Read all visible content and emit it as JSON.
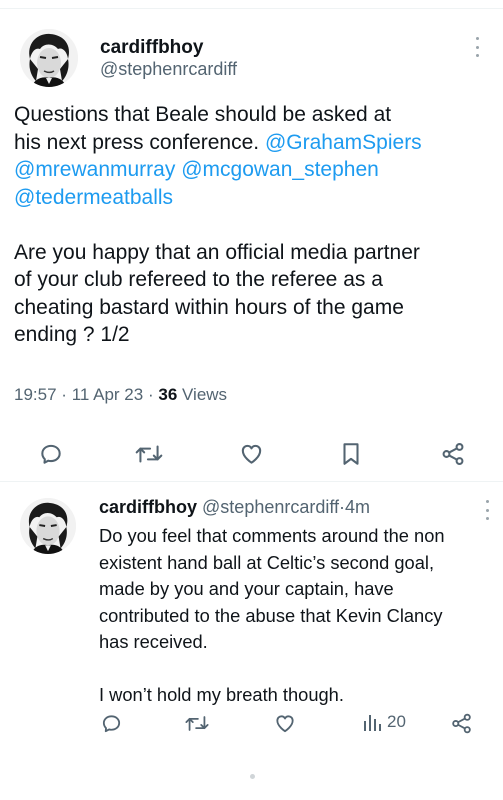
{
  "main_tweet": {
    "display_name": "cardiffbhoy",
    "handle": "@stephenrcardiff",
    "text_lines": [
      "Questions that Beale should be asked at",
      "his next press conference."
    ],
    "mentions": [
      "@GrahamSpiers",
      "@mrewanmurray",
      "@mcgowan_stephen",
      "@tedermeatballs"
    ],
    "body_lines": [
      "Are you happy that an official media partner",
      "of your club refereed to the referee as a",
      "cheating bastard within hours of the game",
      "ending ? 1/2"
    ],
    "time": "19:57",
    "separator": "·",
    "date": "11 Apr 23",
    "views_count": "36",
    "views_label": "Views"
  },
  "reply_tweet": {
    "display_name": "cardiffbhoy",
    "handle": "@stephenrcardiff",
    "separator": "·",
    "age": "4m",
    "text_lines": [
      "Do you feel that comments around the non",
      "existent hand ball at Celtic’s second goal,",
      "made by you and your captain, have",
      "contributed to the abuse that Kevin Clancy",
      "has received."
    ],
    "closing_line": "I won’t hold my breath though.",
    "views": "20"
  },
  "icons": {
    "reply": "reply-icon",
    "retweet": "retweet-icon",
    "like": "heart-icon",
    "bookmark": "bookmark-icon",
    "share": "share-icon",
    "views": "views-icon",
    "more": "more-icon"
  },
  "colors": {
    "link": "#1d9bf0",
    "secondary_text": "#536471",
    "primary_text": "#0f1419",
    "icon": "#536471"
  }
}
